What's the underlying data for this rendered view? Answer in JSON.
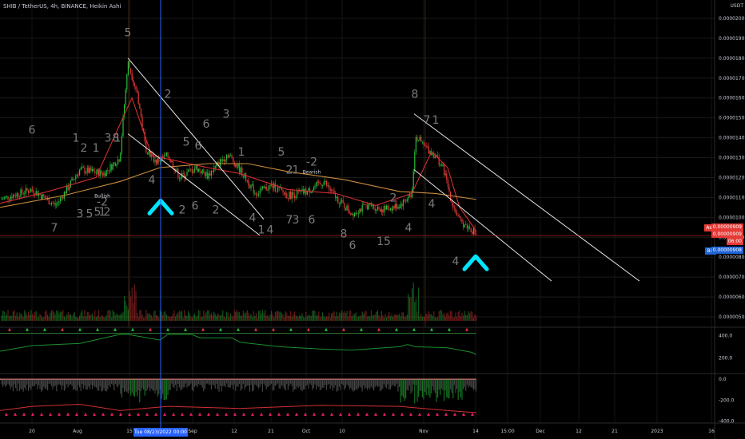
{
  "header": {
    "title": "SHIB / TetherUS, 4h, BINANCE, Heikin Ashi"
  },
  "axis": {
    "currency": "USDT"
  },
  "colors": {
    "background": "#000000",
    "bull_candle": "#26c13a",
    "bear_candle": "#e53935",
    "ma_red": "#d32f2f",
    "ma_orange": "#c98b3c",
    "trendline": "#e6e6e6",
    "cursor_line": "#2962ff",
    "cyan_marker": "#00e5ff",
    "osc_green": "#1b8f2a",
    "osc_red": "#d32f2f"
  },
  "tags": {
    "ask_label": "Ask",
    "ask_value": "0.00000909",
    "last_value": "0.00000909",
    "countdown": "06:00",
    "bid_label": "Bid",
    "bid_value": "0.00000908"
  },
  "cursor": {
    "date_label": "Tue 08/23/2022",
    "time_label": "00:00"
  },
  "chart_data": [
    {
      "type": "candlestick",
      "title": "SHIB / TetherUS, 4h, BINANCE, Heikin Ashi",
      "y_axis_ticks": [
        "0.00002000",
        "0.00001900",
        "0.00001800",
        "0.00001700",
        "0.00001600",
        "0.00001500",
        "0.00001400",
        "0.00001300",
        "0.00001200",
        "0.00001100",
        "0.00001000",
        "0.00000900",
        "0.00000800",
        "0.00000700",
        "0.00000600",
        "0.00000500"
      ],
      "ylim": [
        4.8e-06,
        2.06e-05
      ],
      "x_axis_ticks": [
        "20",
        "Aug",
        "15",
        "Sep",
        "12",
        "21",
        "Oct",
        "10",
        "Nov",
        "14",
        "15:00",
        "Dec",
        "12",
        "21",
        "2023",
        "16"
      ],
      "price_path": [
        [
          0,
          1.09e-05
        ],
        [
          40,
          1.14e-05
        ],
        [
          70,
          1.06e-05
        ],
        [
          100,
          1.24e-05
        ],
        [
          130,
          1.22e-05
        ],
        [
          150,
          1.3e-05
        ],
        [
          160,
          1.78e-05
        ],
        [
          172,
          1.62e-05
        ],
        [
          182,
          1.35e-05
        ],
        [
          195,
          1.28e-05
        ],
        [
          210,
          1.31e-05
        ],
        [
          225,
          1.2e-05
        ],
        [
          245,
          1.25e-05
        ],
        [
          260,
          1.21e-05
        ],
        [
          285,
          1.32e-05
        ],
        [
          300,
          1.24e-05
        ],
        [
          320,
          1.12e-05
        ],
        [
          340,
          1.16e-05
        ],
        [
          360,
          1.11e-05
        ],
        [
          385,
          1.13e-05
        ],
        [
          405,
          1.18e-05
        ],
        [
          420,
          1.1e-05
        ],
        [
          440,
          1.02e-05
        ],
        [
          460,
          1.06e-05
        ],
        [
          480,
          1.04e-05
        ],
        [
          500,
          1.06e-05
        ],
        [
          515,
          1.12e-05
        ],
        [
          520,
          1.41e-05
        ],
        [
          530,
          1.36e-05
        ],
        [
          545,
          1.31e-05
        ],
        [
          555,
          1.24e-05
        ],
        [
          565,
          1.08e-05
        ],
        [
          575,
          9.8e-06
        ],
        [
          590,
          9.4e-06
        ],
        [
          596,
          9.1e-06
        ]
      ],
      "moving_averages": [
        {
          "name": "red",
          "points": [
            [
              0,
              1.07e-05
            ],
            [
              60,
              1.13e-05
            ],
            [
              120,
              1.2e-05
            ],
            [
              165,
              1.6e-05
            ],
            [
              190,
              1.31e-05
            ],
            [
              260,
              1.25e-05
            ],
            [
              300,
              1.22e-05
            ],
            [
              360,
              1.14e-05
            ],
            [
              420,
              1.12e-05
            ],
            [
              470,
              1.06e-05
            ],
            [
              515,
              1.12e-05
            ],
            [
              540,
              1.33e-05
            ],
            [
              560,
              1.25e-05
            ],
            [
              575,
              1.05e-05
            ],
            [
              596,
              9.3e-06
            ]
          ]
        },
        {
          "name": "orange",
          "points": [
            [
              0,
              1.05e-05
            ],
            [
              80,
              1.11e-05
            ],
            [
              150,
              1.18e-05
            ],
            [
              200,
              1.25e-05
            ],
            [
              260,
              1.27e-05
            ],
            [
              310,
              1.27e-05
            ],
            [
              360,
              1.23e-05
            ],
            [
              430,
              1.19e-05
            ],
            [
              500,
              1.13e-05
            ],
            [
              545,
              1.12e-05
            ],
            [
              596,
              1.09e-05
            ]
          ]
        }
      ],
      "trendlines": [
        {
          "from": [
            160,
            1.8e-05
          ],
          "to": [
            330,
            9.9e-06
          ]
        },
        {
          "from": [
            160,
            1.42e-05
          ],
          "to": [
            325,
            9.1e-06
          ]
        },
        {
          "from": [
            518,
            1.52e-05
          ],
          "to": [
            800,
            6.8e-06
          ]
        },
        {
          "from": [
            518,
            1.24e-05
          ],
          "to": [
            690,
            6.8e-06
          ]
        }
      ],
      "annotations": [
        {
          "text": "5",
          "x": 160,
          "y": 1.91e-05
        },
        {
          "text": "2",
          "x": 210,
          "y": 1.6e-05
        },
        {
          "text": "6",
          "x": 40,
          "y": 1.42e-05
        },
        {
          "text": "1",
          "x": 95,
          "y": 1.38e-05
        },
        {
          "text": "2",
          "x": 105,
          "y": 1.33e-05
        },
        {
          "text": "1",
          "x": 120,
          "y": 1.33e-05
        },
        {
          "text": "3",
          "x": 135,
          "y": 1.38e-05
        },
        {
          "text": "1",
          "x": 147,
          "y": 1.38e-05
        },
        {
          "text": "8",
          "x": 145,
          "y": 1.38e-05
        },
        {
          "text": "5",
          "x": 233,
          "y": 1.36e-05
        },
        {
          "text": "6",
          "x": 248,
          "y": 1.34e-05
        },
        {
          "text": "6",
          "x": 258,
          "y": 1.45e-05
        },
        {
          "text": "3",
          "x": 283,
          "y": 1.5e-05
        },
        {
          "text": "1",
          "x": 302,
          "y": 1.31e-05
        },
        {
          "text": "5",
          "x": 352,
          "y": 1.31e-05
        },
        {
          "text": "2",
          "x": 362,
          "y": 1.22e-05
        },
        {
          "text": "1",
          "x": 370,
          "y": 1.22e-05
        },
        {
          "text": "2",
          "x": 492,
          "y": 1.08e-05
        },
        {
          "text": "8",
          "x": 519,
          "y": 1.6e-05
        },
        {
          "text": "7",
          "x": 534,
          "y": 1.47e-05
        },
        {
          "text": "1",
          "x": 545,
          "y": 1.47e-05
        },
        {
          "text": "7",
          "x": 68,
          "y": 9.3e-06
        },
        {
          "text": "3",
          "x": 100,
          "y": 1e-05
        },
        {
          "text": "5",
          "x": 112,
          "y": 1e-05
        },
        {
          "text": "5",
          "x": 122,
          "y": 1.01e-05
        },
        {
          "text": "1",
          "x": 128,
          "y": 1.01e-05
        },
        {
          "text": "2",
          "x": 134,
          "y": 1.01e-05
        },
        {
          "text": "4",
          "x": 190,
          "y": 1.17e-05
        },
        {
          "text": "2",
          "x": 228,
          "y": 1.02e-05
        },
        {
          "text": "6",
          "x": 244,
          "y": 1.04e-05
        },
        {
          "text": "2",
          "x": 270,
          "y": 1.02e-05
        },
        {
          "text": "4",
          "x": 316,
          "y": 9.8e-06
        },
        {
          "text": "1",
          "x": 327,
          "y": 9.2e-06
        },
        {
          "text": "4",
          "x": 338,
          "y": 9.2e-06
        },
        {
          "text": "7",
          "x": 362,
          "y": 9.7e-06
        },
        {
          "text": "3",
          "x": 370,
          "y": 9.7e-06
        },
        {
          "text": "6",
          "x": 390,
          "y": 9.7e-06
        },
        {
          "text": "8",
          "x": 430,
          "y": 9e-06
        },
        {
          "text": "6",
          "x": 441,
          "y": 8.4e-06
        },
        {
          "text": "15",
          "x": 480,
          "y": 8.6e-06
        },
        {
          "text": "4",
          "x": 511,
          "y": 9.3e-06
        },
        {
          "text": "4",
          "x": 540,
          "y": 1.05e-05
        },
        {
          "text": "4",
          "x": 570,
          "y": 7.6e-06
        },
        {
          "text": "Bullish",
          "x": 128,
          "y": 1.1e-05
        },
        {
          "text": "-2",
          "x": 128,
          "y": 1.06e-05
        },
        {
          "text": "Bearish",
          "x": 390,
          "y": 1.22e-05
        },
        {
          "text": "-2",
          "x": 390,
          "y": 1.26e-05
        }
      ],
      "markers": [
        {
          "shape": "cyan-chevron-up",
          "x": 201,
          "y": 1.06e-05
        },
        {
          "shape": "cyan-chevron-up",
          "x": 595,
          "y": 7.8e-06
        }
      ]
    },
    {
      "type": "line",
      "title": "",
      "y_axis_ticks": [
        "400.0",
        "200.0"
      ],
      "ylim": [
        60,
        460
      ],
      "series": [
        {
          "points": [
            [
              0,
              260
            ],
            [
              40,
              310
            ],
            [
              100,
              330
            ],
            [
              150,
              410
            ],
            [
              160,
              410
            ],
            [
              200,
              360
            ],
            [
              210,
              410
            ],
            [
              240,
              410
            ],
            [
              250,
              380
            ],
            [
              290,
              380
            ],
            [
              300,
              340
            ],
            [
              350,
              300
            ],
            [
              400,
              280
            ],
            [
              440,
              270
            ],
            [
              500,
              300
            ],
            [
              510,
              320
            ],
            [
              520,
              300
            ],
            [
              560,
              290
            ],
            [
              590,
              250
            ],
            [
              596,
              230
            ]
          ]
        }
      ]
    },
    {
      "type": "area",
      "title": "",
      "y_axis_ticks": [
        "0.0",
        "-200.0",
        "-400.0"
      ],
      "ylim": [
        -420,
        40
      ]
    }
  ]
}
